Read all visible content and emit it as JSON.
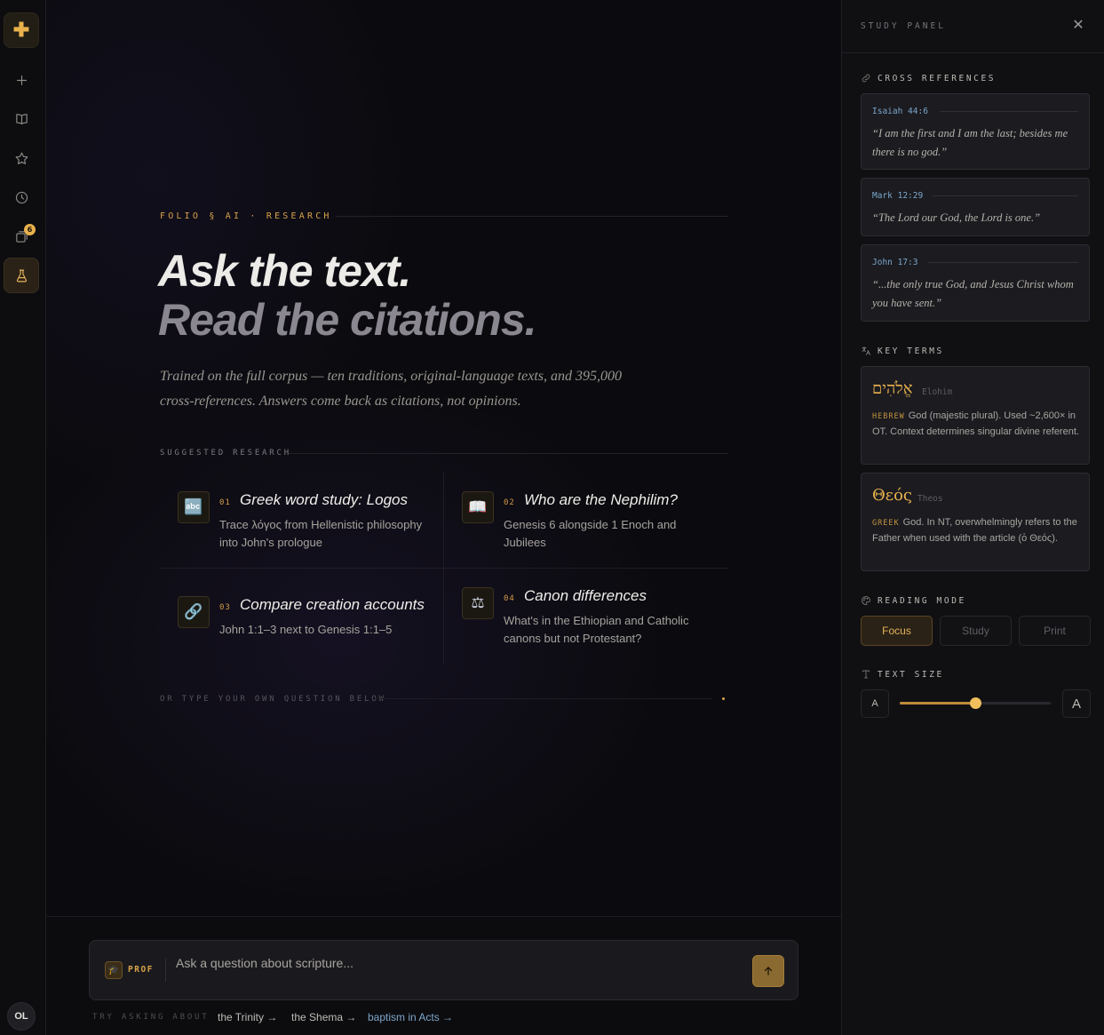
{
  "rail": {
    "logo_glyph": "✚",
    "notification_count": "6",
    "user_initials": "OL",
    "items": [
      {
        "name": "new-icon"
      },
      {
        "name": "book-icon"
      },
      {
        "name": "star-icon"
      },
      {
        "name": "history-icon"
      },
      {
        "name": "collections-icon"
      },
      {
        "name": "lab-icon",
        "active": true
      }
    ]
  },
  "main": {
    "eyebrow": "FOLIO § AI · RESEARCH",
    "headline_1": "Ask the text.",
    "headline_2": "Read the citations.",
    "lede": "Trained on the full corpus — ten traditions, original-language texts, and 395,000 cross-references. Answers come back as citations, not opinions.",
    "suggested_label": "SUGGESTED RESEARCH",
    "suggestions": [
      {
        "num": "01",
        "icon": "🔤",
        "icon_name": "abc-icon",
        "title": "Greek word study: Logos",
        "desc": "Trace λόγος from Hellenistic philosophy into John's prologue"
      },
      {
        "num": "02",
        "icon": "📖",
        "icon_name": "open-book-icon",
        "title": "Who are the Nephilim?",
        "desc": "Genesis 6 alongside 1 Enoch and Jubilees"
      },
      {
        "num": "03",
        "icon": "🔗",
        "icon_name": "link-icon",
        "title": "Compare creation accounts",
        "desc": "John 1:1–3 next to Genesis 1:1–5"
      },
      {
        "num": "04",
        "icon": "⚖",
        "icon_name": "scales-icon",
        "title": "Canon differences",
        "desc": "What's in the Ethiopian and Catholic canons but not Protestant?"
      }
    ],
    "own_question_label": "OR TYPE YOUR OWN QUESTION BELOW"
  },
  "composer": {
    "mode_label": "PROF",
    "mode_icon": "🎓",
    "placeholder": "Ask a question about scripture...",
    "try_label": "TRY ASKING ABOUT",
    "chips": [
      "the Trinity →",
      "the Shema →",
      "baptism in Acts →"
    ]
  },
  "panel": {
    "title": "STUDY PANEL",
    "close_glyph": "✕",
    "cross_refs_label": "CROSS REFERENCES",
    "cross_refs": [
      {
        "ref": "Isaiah 44:6",
        "quote": "“I am the first and I am the last; besides me there is no god.”"
      },
      {
        "ref": "Mark 12:29",
        "quote": "“The Lord our God, the Lord is one.”"
      },
      {
        "ref": "John 17:3",
        "quote": "“...the only true God, and Jesus Christ whom you have sent.”"
      }
    ],
    "key_terms_label": "KEY TERMS",
    "terms": [
      {
        "word": "אֱלֹהִים",
        "translit": "Elohim",
        "lang": "HEBREW",
        "def": "God (majestic plural). Used ~2,600× in OT. Context determines singular divine referent."
      },
      {
        "word": "Θεός",
        "translit": "Theos",
        "lang": "GREEK",
        "def": "God. In NT, overwhelmingly refers to the Father when used with the article (ὁ Θεός)."
      }
    ],
    "reading_mode_label": "READING MODE",
    "reading_modes": [
      "Focus",
      "Study",
      "Print"
    ],
    "reading_mode_selected": "Focus",
    "text_size_label": "TEXT SIZE",
    "text_size_small": "A",
    "text_size_large": "A",
    "text_size_level": 0.5
  },
  "colors": {
    "accent": "#e9b24d",
    "link": "#7ba7cc",
    "background": "#0b0b0f"
  }
}
